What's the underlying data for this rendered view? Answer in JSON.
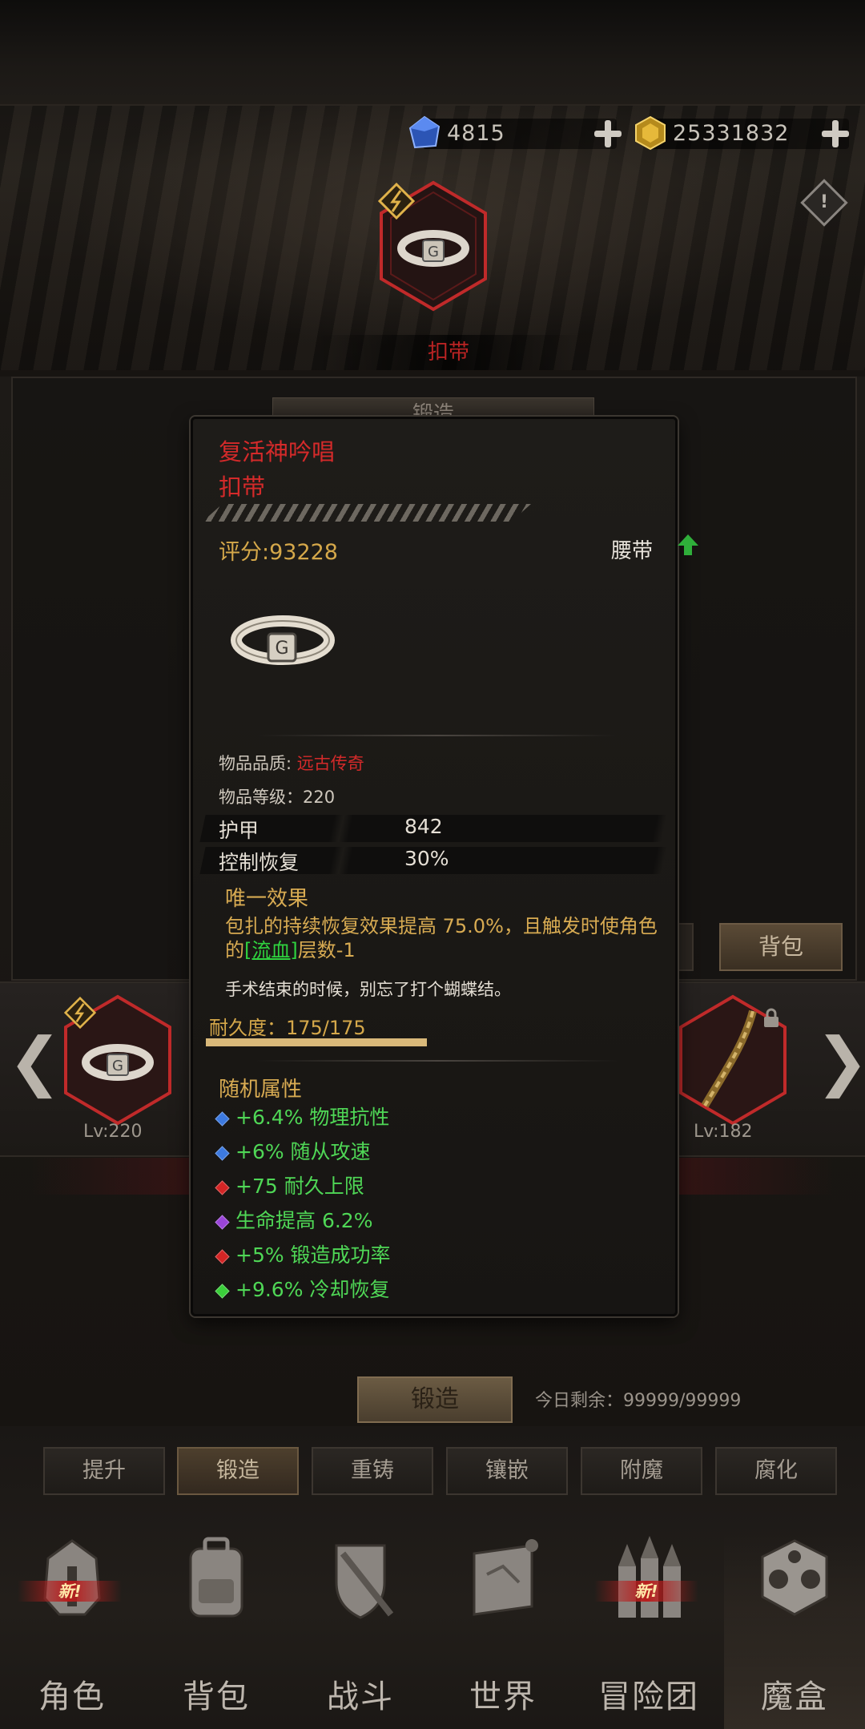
{
  "currency": {
    "gems": "4815",
    "gold": "25331832"
  },
  "item_header": {
    "name": "扣带"
  },
  "background": {
    "forge_tab_hidden": "锻造"
  },
  "carousel": {
    "left_level": "Lv:220",
    "right_level": "Lv:182"
  },
  "side_buttons": {
    "bag": "背包"
  },
  "forge": {
    "button": "锻造",
    "remaining": "今日剩余：99999/99999"
  },
  "tabs": [
    "提升",
    "锻造",
    "重铸",
    "镶嵌",
    "附魔",
    "腐化"
  ],
  "bottom_nav": {
    "items": [
      "角色",
      "背包",
      "战斗",
      "世界",
      "冒险团",
      "魔盒"
    ],
    "new_badge": "新!"
  },
  "tooltip": {
    "name": "复活神吟唱",
    "type": "扣带",
    "score": "评分:93228",
    "slot": "腰带",
    "quality_label": "物品品质:",
    "quality_value": "远古传奇",
    "level_text": "物品等级：220",
    "stats": [
      {
        "label": "护甲",
        "value": "842"
      },
      {
        "label": "控制恢复",
        "value": "30%"
      }
    ],
    "unique_title": "唯一效果",
    "unique_part1": "包扎的持续恢复效果提高 75.0%，且触发时使角色的",
    "unique_highlight": "[流血]",
    "unique_part2": "层数-1",
    "flavor": "手术结束的时候，别忘了打个蝴蝶结。",
    "durability": "耐久度：175/175",
    "durability_fraction": 1.0,
    "random_title": "随机属性",
    "random_stats": [
      {
        "text": "+6.4% 物理抗性",
        "gem_color": "#3d7ae0"
      },
      {
        "text": "+6% 随从攻速",
        "gem_color": "#3d7ae0"
      },
      {
        "text": "+75 耐久上限",
        "gem_color": "#d42525"
      },
      {
        "text": "生命提高 6.2%",
        "gem_color": "#9a45d8"
      },
      {
        "text": "+5% 锻造成功率",
        "gem_color": "#d42525"
      },
      {
        "text": "+9.6% 冷却恢复",
        "gem_color": "#3bcf3b"
      }
    ]
  },
  "colors": {
    "legendary_red": "#d42a2a",
    "gold_text": "#d8ab52",
    "random_green": "#4fd756",
    "accent_bronze": "#6b5a44"
  }
}
